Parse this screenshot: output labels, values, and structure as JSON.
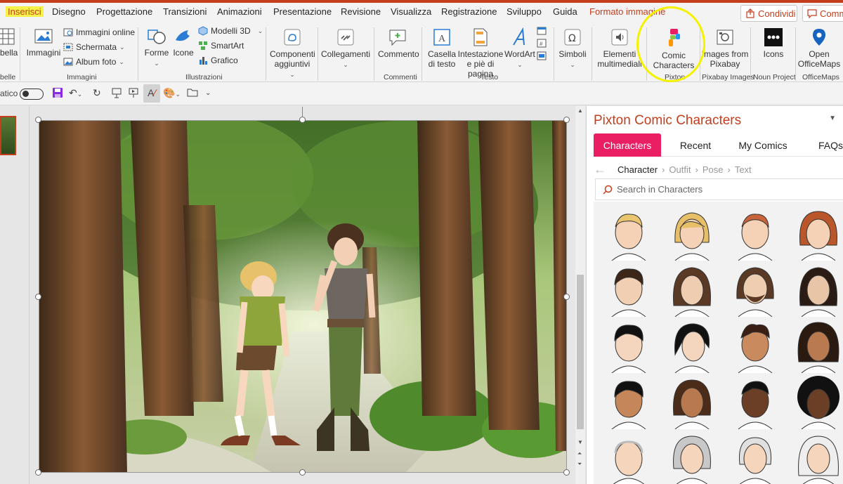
{
  "tabs": [
    {
      "label": "Inserisci",
      "active": true
    },
    {
      "label": "Disegno"
    },
    {
      "label": "Progettazione"
    },
    {
      "label": "Transizioni"
    },
    {
      "label": "Animazioni"
    },
    {
      "label": "Presentazione"
    },
    {
      "label": "Revisione"
    },
    {
      "label": "Visualizza"
    },
    {
      "label": "Registrazione"
    },
    {
      "label": "Sviluppo"
    },
    {
      "label": "Guida"
    },
    {
      "label": "Formato immagine",
      "context": true
    }
  ],
  "share_label": "Condividi",
  "comments_label": "Comm",
  "ribbon": {
    "tabella": "bella",
    "immagini": "Immagini",
    "immagini_online": "Immagini online",
    "schermata": "Schermata",
    "album_foto": "Album foto",
    "forme": "Forme",
    "icone": "Icone",
    "modelli3d": "Modelli 3D",
    "smartart": "SmartArt",
    "grafico": "Grafico",
    "componenti": "Componenti aggiuntivi",
    "collegamenti": "Collegamenti",
    "commento": "Commento",
    "casella": "Casella di testo",
    "intestazione": "Intestazione e piè di pagina",
    "wordart": "WordArt",
    "simboli": "Simboli",
    "elementi": "Elementi multimediali",
    "comic": "Comic Characters",
    "pixabay": "Images from Pixabay",
    "icons": "Icons",
    "officemaps": "Open OfficeMaps",
    "groups": {
      "tabelle": "belle",
      "immagini": "Immagini",
      "illustrazioni": "Illustrazioni",
      "commenti": "Commenti",
      "testo": "Testo",
      "pixton": "Pixton",
      "pixabay": "Pixabay Images",
      "noun": "Noun Project",
      "officemaps": "OfficeMaps"
    }
  },
  "qat": {
    "autosave": "atico"
  },
  "pane": {
    "title": "Pixton Comic Characters",
    "tabs": [
      "Characters",
      "Recent",
      "My Comics",
      "FAQs"
    ],
    "active_tab": "Characters",
    "breadcrumb": [
      "Character",
      "Outfit",
      "Pose",
      "Text"
    ],
    "search_placeholder": "Search in Characters"
  },
  "colors": {
    "accent": "#c43e1c",
    "pixton_pink": "#e91e63",
    "highlight": "#f5f200"
  }
}
